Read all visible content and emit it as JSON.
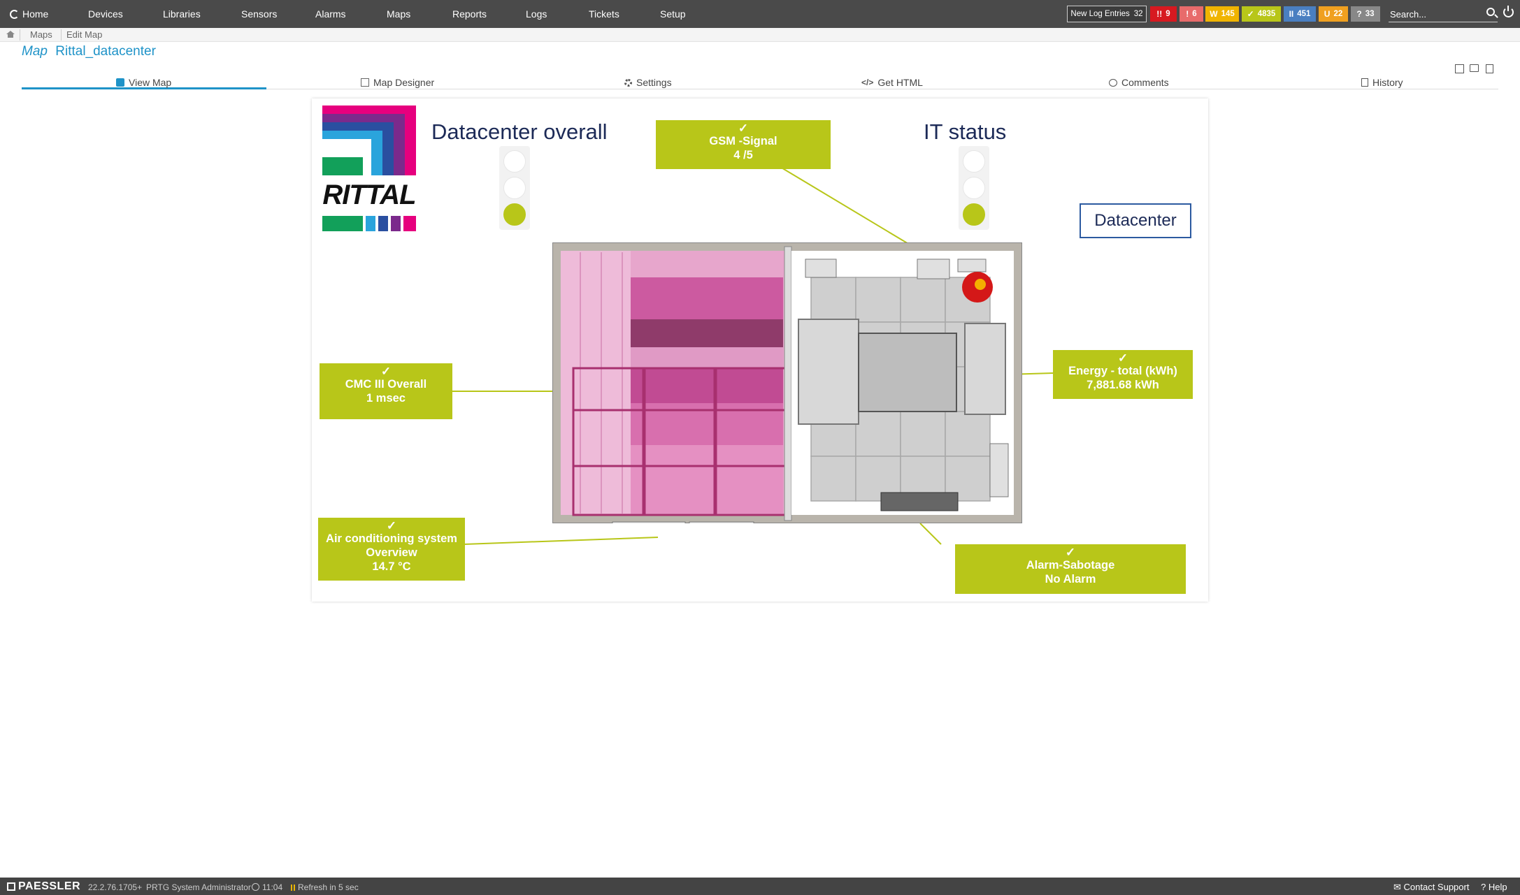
{
  "nav": {
    "items": [
      "Home",
      "Devices",
      "Libraries",
      "Sensors",
      "Alarms",
      "Maps",
      "Reports",
      "Logs",
      "Tickets",
      "Setup"
    ],
    "new_log_label": "New Log Entries",
    "new_log_count": "32",
    "badges": [
      {
        "icon": "!!",
        "count": "9",
        "color": "#d71920"
      },
      {
        "icon": "!",
        "count": "6",
        "color": "#e86b6b"
      },
      {
        "icon": "W",
        "count": "145",
        "color": "#f0b400"
      },
      {
        "icon": "✓",
        "count": "4835",
        "color": "#b8c619"
      },
      {
        "icon": "II",
        "count": "451",
        "color": "#4a7fc1"
      },
      {
        "icon": "U",
        "count": "22",
        "color": "#f0a020"
      },
      {
        "icon": "?",
        "count": "33",
        "color": "#888888"
      }
    ],
    "search_placeholder": "Search..."
  },
  "breadcrumb": [
    "Maps",
    "Edit Map"
  ],
  "title": {
    "label": "Map",
    "name": "Rittal_datacenter"
  },
  "tabs": [
    "View Map",
    "Map Designer",
    "Settings",
    "Get HTML",
    "Comments",
    "History"
  ],
  "map": {
    "logo_text": "RITTAL",
    "title_left": "Datacenter overall",
    "title_right": "IT status",
    "datacenter_label": "Datacenter",
    "traffic_left": {
      "lit": "green"
    },
    "traffic_right": {
      "lit": "green"
    },
    "sensors": {
      "gsm": {
        "name": "GSM -Signal",
        "value": "4 /5",
        "status": "ok"
      },
      "cmc": {
        "name": "CMC III Overall",
        "value": "1 msec",
        "status": "ok"
      },
      "energy": {
        "name": "Energy - total (kWh)",
        "value": "7,881.68 kWh",
        "status": "ok"
      },
      "air": {
        "name": "Air conditioning system",
        "name2": "Overview",
        "value": "14.7 °C",
        "status": "ok"
      },
      "alarm": {
        "name": "Alarm-Sabotage",
        "value": "No Alarm",
        "status": "ok"
      }
    },
    "accent": "#b8c619"
  },
  "footer": {
    "brand": "PAESSLER",
    "version": "22.2.76.1705+",
    "user": "PRTG System Administrator",
    "time": "11:04",
    "refresh": "Refresh in 5 sec",
    "contact": "Contact Support",
    "help": "Help"
  }
}
